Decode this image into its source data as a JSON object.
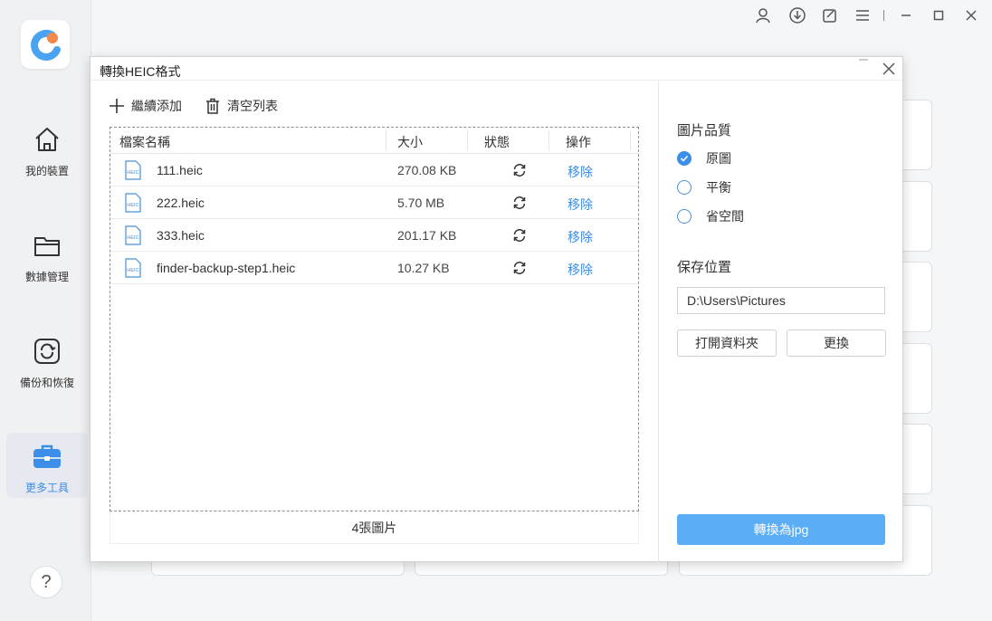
{
  "sidebar": {
    "items": [
      {
        "label": "我的裝置",
        "icon": "home-icon"
      },
      {
        "label": "數據管理",
        "icon": "folder-icon"
      },
      {
        "label": "備份和恢復",
        "icon": "backup-icon"
      },
      {
        "label": "更多工具",
        "icon": "toolbox-icon",
        "active": true
      }
    ],
    "help_label": "?"
  },
  "dialog": {
    "title": "轉換HEIC格式",
    "toolbar": {
      "add_label": "繼續添加",
      "clear_label": "清空列表"
    },
    "table": {
      "headers": [
        "檔案名稱",
        "大小",
        "狀態",
        "操作"
      ],
      "rows": [
        {
          "name": "111.heic",
          "size": "270.08 KB",
          "action": "移除"
        },
        {
          "name": "222.heic",
          "size": "5.70 MB",
          "action": "移除"
        },
        {
          "name": "333.heic",
          "size": "201.17 KB",
          "action": "移除"
        },
        {
          "name": "finder-backup-step1.heic",
          "size": "10.27 KB",
          "action": "移除"
        }
      ]
    },
    "file_icon_text": "HEIC",
    "count_label": "4張圖片",
    "quality": {
      "label": "圖片品質",
      "options": [
        {
          "label": "原圖",
          "checked": true
        },
        {
          "label": "平衡",
          "checked": false
        },
        {
          "label": "省空間",
          "checked": false
        }
      ]
    },
    "save": {
      "label": "保存位置",
      "path": "D:\\Users\\Pictures",
      "open_folder_label": "打開資料夾",
      "change_label": "更換"
    },
    "convert_label": "轉換為jpg"
  },
  "colors": {
    "accent": "#3d8ee8",
    "convert_button": "#5badf5"
  }
}
